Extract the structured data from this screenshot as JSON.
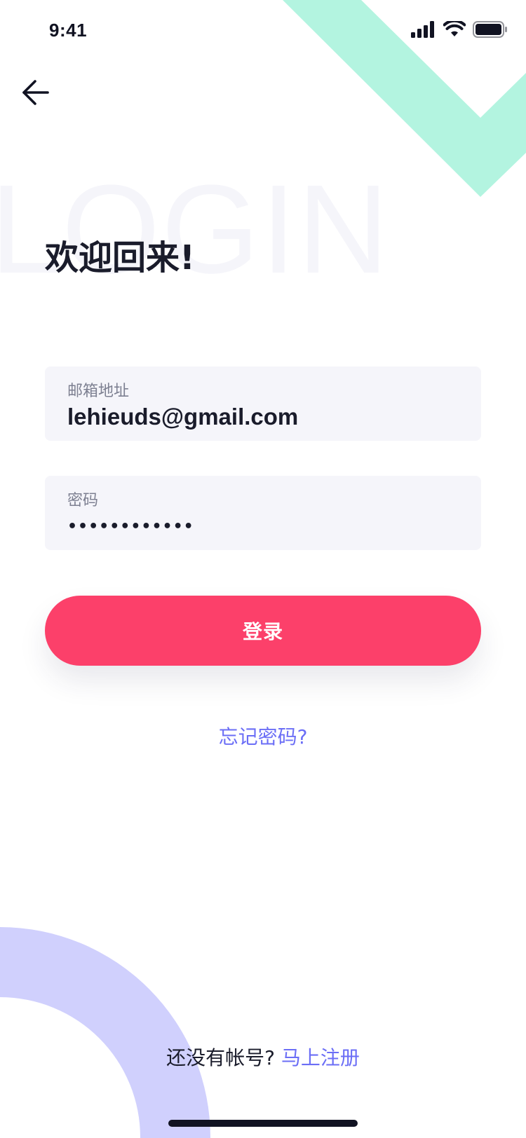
{
  "status_bar": {
    "time": "9:41",
    "icons": [
      "signal-icon",
      "wifi-icon",
      "battery-icon"
    ]
  },
  "header": {
    "back_icon": "arrow-left-icon"
  },
  "hero": {
    "watermark": "LOGIN",
    "title": "欢迎回来!"
  },
  "form": {
    "email_label": "邮箱地址",
    "email_value": "lehieuds@gmail.com",
    "password_label": "密码",
    "password_value": "••••••••••••"
  },
  "actions": {
    "login_label": "登录",
    "forgot_password": "忘记密码?"
  },
  "footer": {
    "signup_prompt": "还没有帐号?",
    "signup_link": "马上注册"
  },
  "colors": {
    "accent": "#fc406a",
    "link": "#6b6ef6",
    "deco_green": "#b3f4e0",
    "deco_purple": "#d0d0fd",
    "field_bg": "#f5f5fa"
  }
}
